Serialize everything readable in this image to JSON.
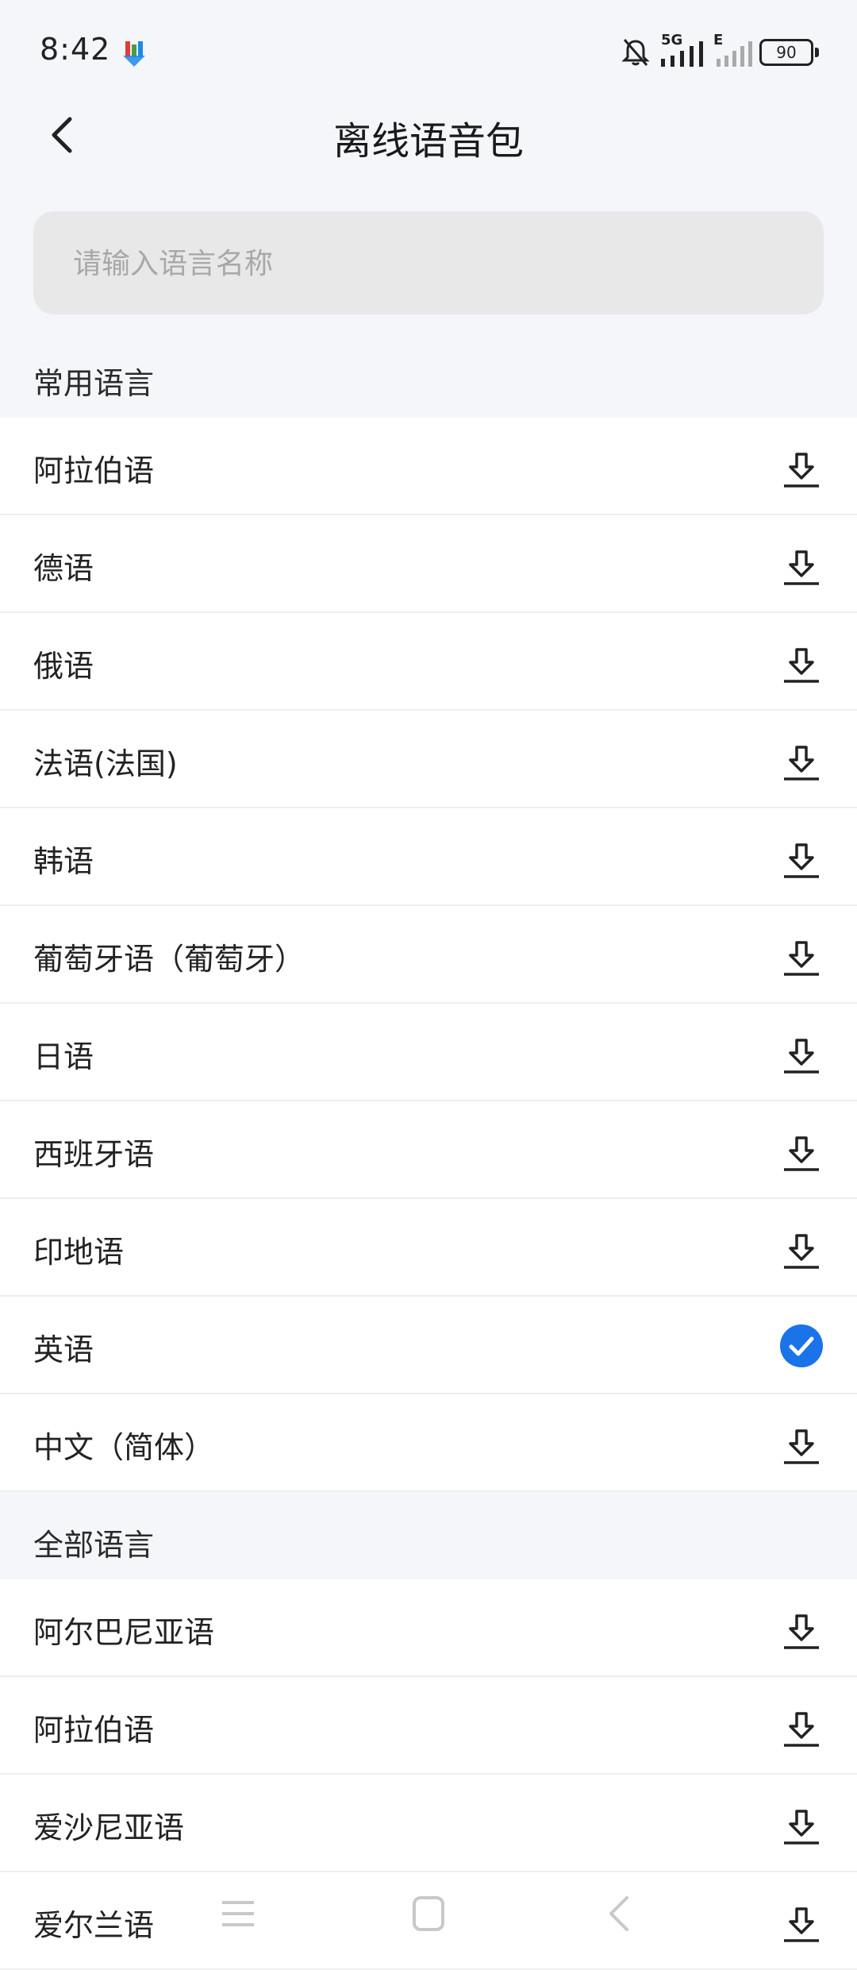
{
  "status_bar": {
    "time": "8:42",
    "network": "5G",
    "network2": "E",
    "battery": "90"
  },
  "header": {
    "title": "离线语音包",
    "back_icon": "chevron-left-icon"
  },
  "search": {
    "placeholder": "请输入语言名称"
  },
  "common_section": {
    "title": "常用语言",
    "items": [
      {
        "label": "阿拉伯语",
        "status": "download"
      },
      {
        "label": "德语",
        "status": "download"
      },
      {
        "label": "俄语",
        "status": "download"
      },
      {
        "label": "法语(法国)",
        "status": "download"
      },
      {
        "label": "韩语",
        "status": "download"
      },
      {
        "label": "葡萄牙语（葡萄牙）",
        "status": "download"
      },
      {
        "label": "日语",
        "status": "download"
      },
      {
        "label": "西班牙语",
        "status": "download"
      },
      {
        "label": "印地语",
        "status": "download"
      },
      {
        "label": "英语",
        "status": "downloaded"
      },
      {
        "label": "中文（简体）",
        "status": "download"
      }
    ]
  },
  "all_section": {
    "title": "全部语言",
    "items": [
      {
        "label": "阿尔巴尼亚语",
        "status": "download"
      },
      {
        "label": "阿拉伯语",
        "status": "download"
      },
      {
        "label": "爱沙尼亚语",
        "status": "download"
      },
      {
        "label": "爱尔兰语",
        "status": "download"
      }
    ]
  },
  "colors": {
    "accent": "#1A73E8",
    "background": "#F4F6FA",
    "search_bg": "#E8E8E8"
  },
  "nav_bar": {
    "icons": [
      "menu-icon",
      "home-icon",
      "back-icon"
    ]
  }
}
